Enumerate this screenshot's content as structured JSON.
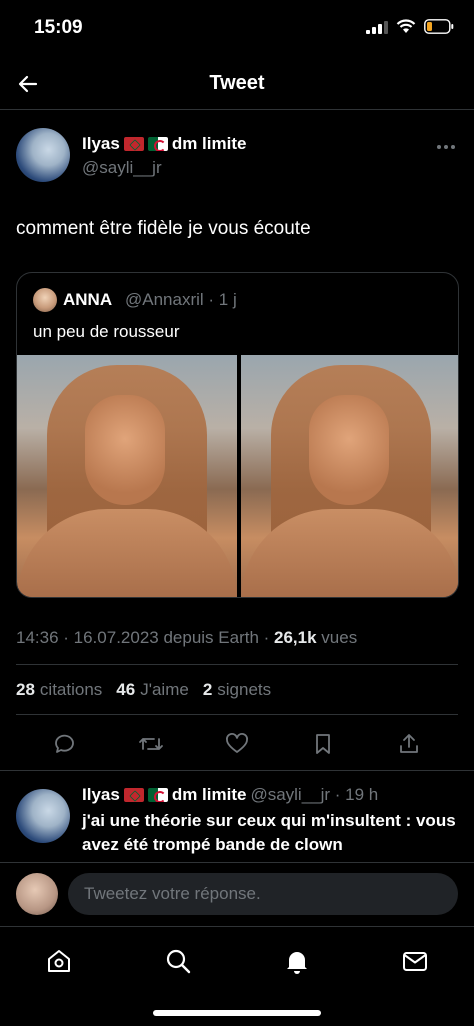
{
  "status_bar": {
    "time": "15:09"
  },
  "header": {
    "title": "Tweet"
  },
  "tweet": {
    "author_name": "Ilyas",
    "author_name_suffix": "dm limite",
    "author_handle": "@sayli__jr",
    "text": "comment être fidèle je vous écoute",
    "quote": {
      "name": "ANNA",
      "meta": "@Annaxril · 1 j",
      "text": "un peu de rousseur"
    },
    "timestamp": "14:36 · 16.07.2023 depuis Earth · ",
    "views_count": "26,1k",
    "views_label": " vues",
    "stats": {
      "citations_count": "28",
      "citations_label": "citations",
      "likes_count": "46",
      "likes_label": "J'aime",
      "bookmarks_count": "2",
      "bookmarks_label": "signets"
    }
  },
  "reply": {
    "name": "Ilyas",
    "name_suffix": "dm limite",
    "meta": "@sayli__jr · 19 h",
    "text": "j'ai une théorie sur ceux qui m'insultent : vous avez été trompé bande de clown"
  },
  "compose": {
    "placeholder": "Tweetez votre réponse."
  },
  "colors": {
    "background": "#000000",
    "muted": "#71767b",
    "text": "#e7e9ea",
    "divider": "#2f3336"
  },
  "icons": [
    "back-arrow-icon",
    "more-icon",
    "reply-icon",
    "retweet-icon",
    "like-icon",
    "bookmark-icon",
    "share-icon",
    "home-icon",
    "search-icon",
    "notifications-icon",
    "messages-icon"
  ]
}
